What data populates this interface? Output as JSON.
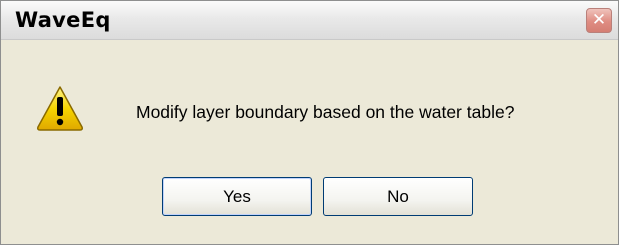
{
  "window": {
    "title": "WaveEq",
    "close_symbol": "✕"
  },
  "dialog": {
    "icon": "warning-icon",
    "message": "Modify layer boundary based on the water table?",
    "yes_label": "Yes",
    "no_label": "No"
  },
  "colors": {
    "dialog_bg": "#ece9d8",
    "close_button": "#d57e73",
    "warning_yellow": "#f5d400"
  }
}
